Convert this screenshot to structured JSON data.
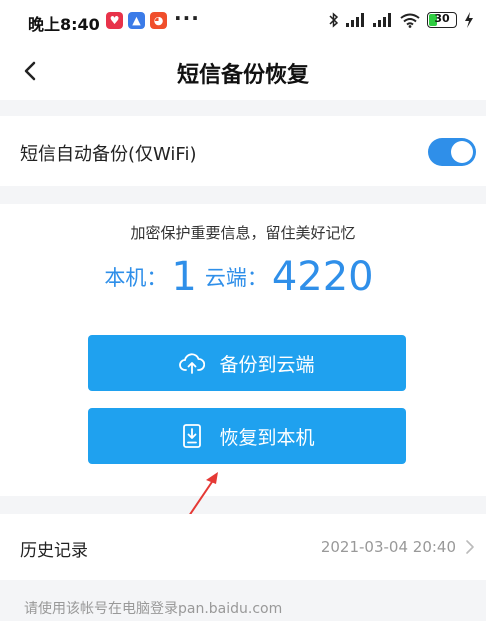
{
  "status_bar": {
    "time": "晚上8:40",
    "more": "···",
    "battery": "30",
    "battery_level": 0.3
  },
  "header": {
    "title": "短信备份恢复"
  },
  "auto_backup": {
    "label": "短信自动备份(仅WiFi)",
    "enabled": true
  },
  "summary": {
    "tagline": "加密保护重要信息，留住美好记忆",
    "local_label": "本机：",
    "local_count": "1",
    "cloud_label": "云端：",
    "cloud_count": "4220"
  },
  "actions": {
    "backup_label": "备份到云端",
    "restore_label": "恢复到本机"
  },
  "history": {
    "label": "历史记录",
    "last_time": "2021-03-04 20:40"
  },
  "footer": {
    "note": "请使用该帐号在电脑登录pan.baidu.com"
  },
  "colors": {
    "accent": "#1fa1ef",
    "count_text": "#2f8fe9",
    "toggle_on": "#2f8fe9",
    "annotation_arrow": "#e53935"
  }
}
